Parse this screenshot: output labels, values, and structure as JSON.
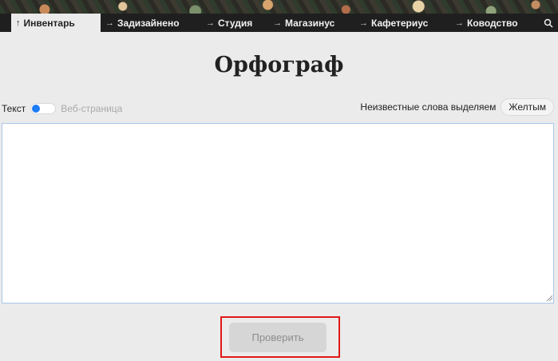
{
  "nav": {
    "tabs": [
      {
        "label": "Инвентарь",
        "active": true
      },
      {
        "label": "Задизайнено",
        "active": false
      },
      {
        "label": "Студия",
        "active": false
      },
      {
        "label": "Магазинус",
        "active": false
      },
      {
        "label": "Кафетериус",
        "active": false
      },
      {
        "label": "Ководство",
        "active": false
      }
    ],
    "arrow_icon": "arrow-icon",
    "search_icon": "search-icon"
  },
  "page": {
    "title": "Орфограф"
  },
  "mode_switch": {
    "label_left": "Текст",
    "label_right": "Веб-страница",
    "state": "Текст",
    "accent_color": "#1e7bf5"
  },
  "highlight": {
    "label": "Неизвестные слова выделяем",
    "color_button": "Желтым"
  },
  "editor": {
    "value": "",
    "border_color": "#a9c7ea"
  },
  "actions": {
    "check_label": "Проверить",
    "frame_color": "#e01818"
  }
}
